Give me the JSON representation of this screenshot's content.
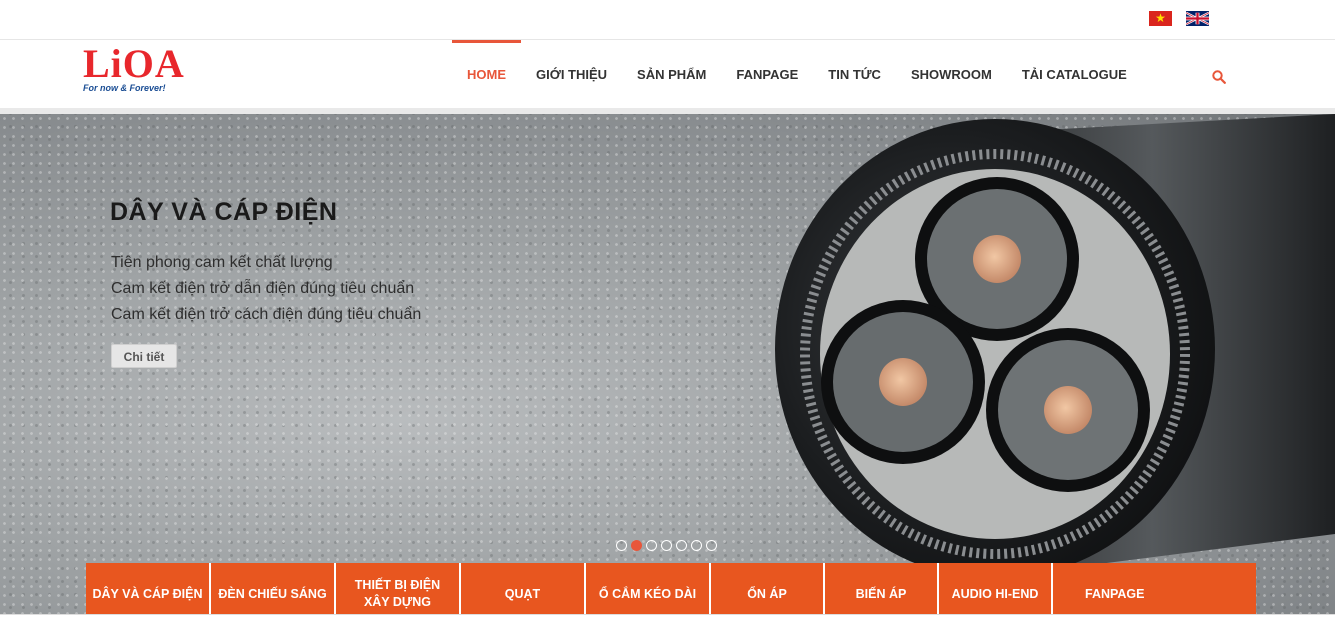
{
  "languages": [
    {
      "name": "Tiếng Việt",
      "icon": "vietnam-flag-icon"
    },
    {
      "name": "English",
      "icon": "uk-flag-icon"
    }
  ],
  "logo": {
    "text": "LiOA",
    "tagline": "For now & Forever!"
  },
  "nav": {
    "items": [
      "HOME",
      "GIỚI THIỆU",
      "SẢN PHẨM",
      "FANPAGE",
      "TIN TỨC",
      "SHOWROOM",
      "TẢI CATALOGUE"
    ],
    "active": "HOME",
    "search_icon": "search-icon"
  },
  "hero": {
    "title": "DÂY VÀ CÁP ĐIỆN",
    "lines": [
      "Tiên phong cam kết chất lượng",
      "Cam kết điện trở dẫn điện đúng tiêu chuẩn",
      "Cam kết điện trở cách điện đúng tiêu chuẩn"
    ],
    "button_label": "Chi tiết",
    "slide_count": 7,
    "active_slide": 2
  },
  "categories": [
    "DÂY VÀ CÁP ĐIỆN",
    "ĐÈN CHIẾU SÁNG",
    "THIẾT BỊ ĐIỆN XÂY DỰNG",
    "QUẠT",
    "Ổ CẮM KÉO DÀI",
    "ỔN ÁP",
    "BIẾN ÁP",
    "AUDIO HI-END",
    "FANPAGE"
  ],
  "colors": {
    "accent": "#e8563a",
    "category_bar": "#e8561f",
    "logo_red": "#e8272c",
    "logo_blue": "#1a4d94"
  }
}
